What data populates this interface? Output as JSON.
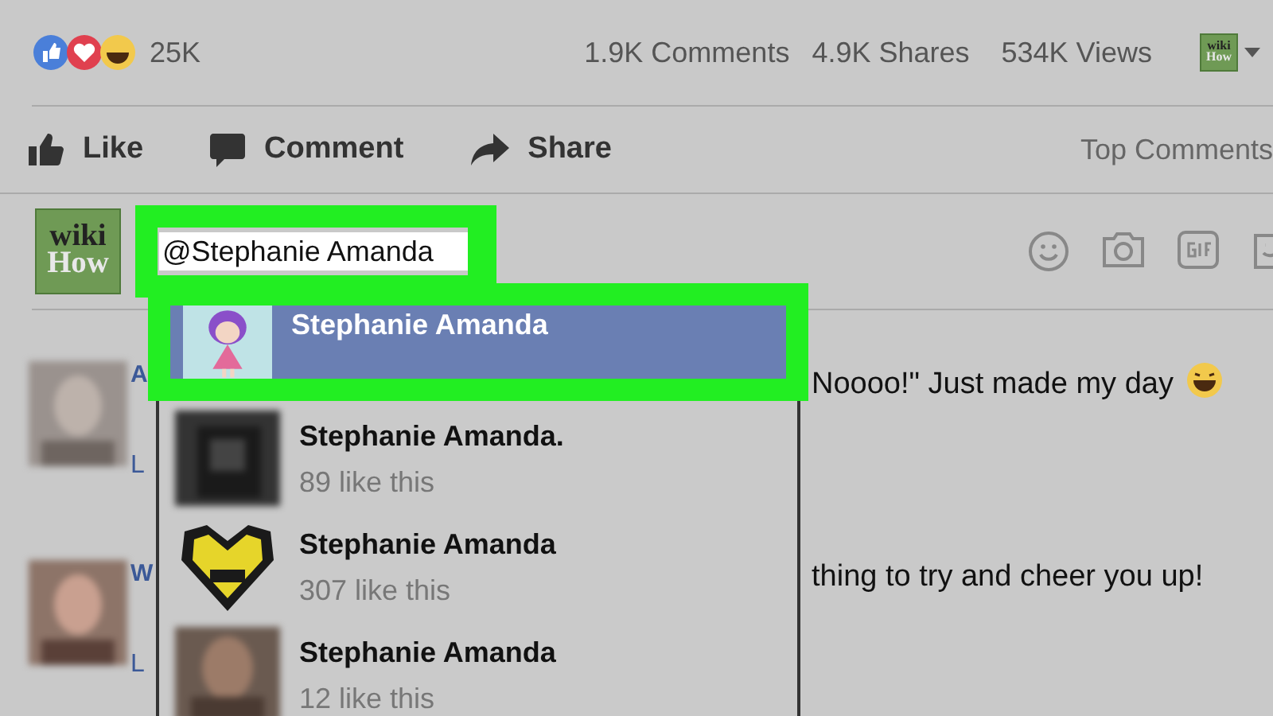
{
  "stats": {
    "reaction_count": "25K",
    "comments": "1.9K Comments",
    "shares": "4.9K Shares",
    "views": "534K Views",
    "page_logo": [
      "wiki",
      "How"
    ]
  },
  "actions": [
    {
      "kind": "like",
      "label": "Like"
    },
    {
      "kind": "comment",
      "label": "Comment"
    },
    {
      "kind": "share",
      "label": "Share"
    }
  ],
  "sort": "Top Comments",
  "composer": {
    "avatar": [
      "wiki",
      "How"
    ],
    "value": "@Stephanie Amanda"
  },
  "comments": [
    {
      "name": "A",
      "text": "Noooo!\" Just made my day",
      "link": "L"
    },
    {
      "name": "W",
      "text": "thing to try and cheer you up!",
      "link": "L"
    }
  ],
  "suggestions": [
    {
      "name": "Stephanie Amanda",
      "selected": true
    },
    {
      "name": "Stephanie Amanda.",
      "likes": "89 like this",
      "selected": false
    },
    {
      "name": "Stephanie Amanda",
      "likes": "307 like this",
      "selected": false
    },
    {
      "name": "Stephanie Amanda",
      "likes": "12 like this",
      "selected": false
    }
  ]
}
